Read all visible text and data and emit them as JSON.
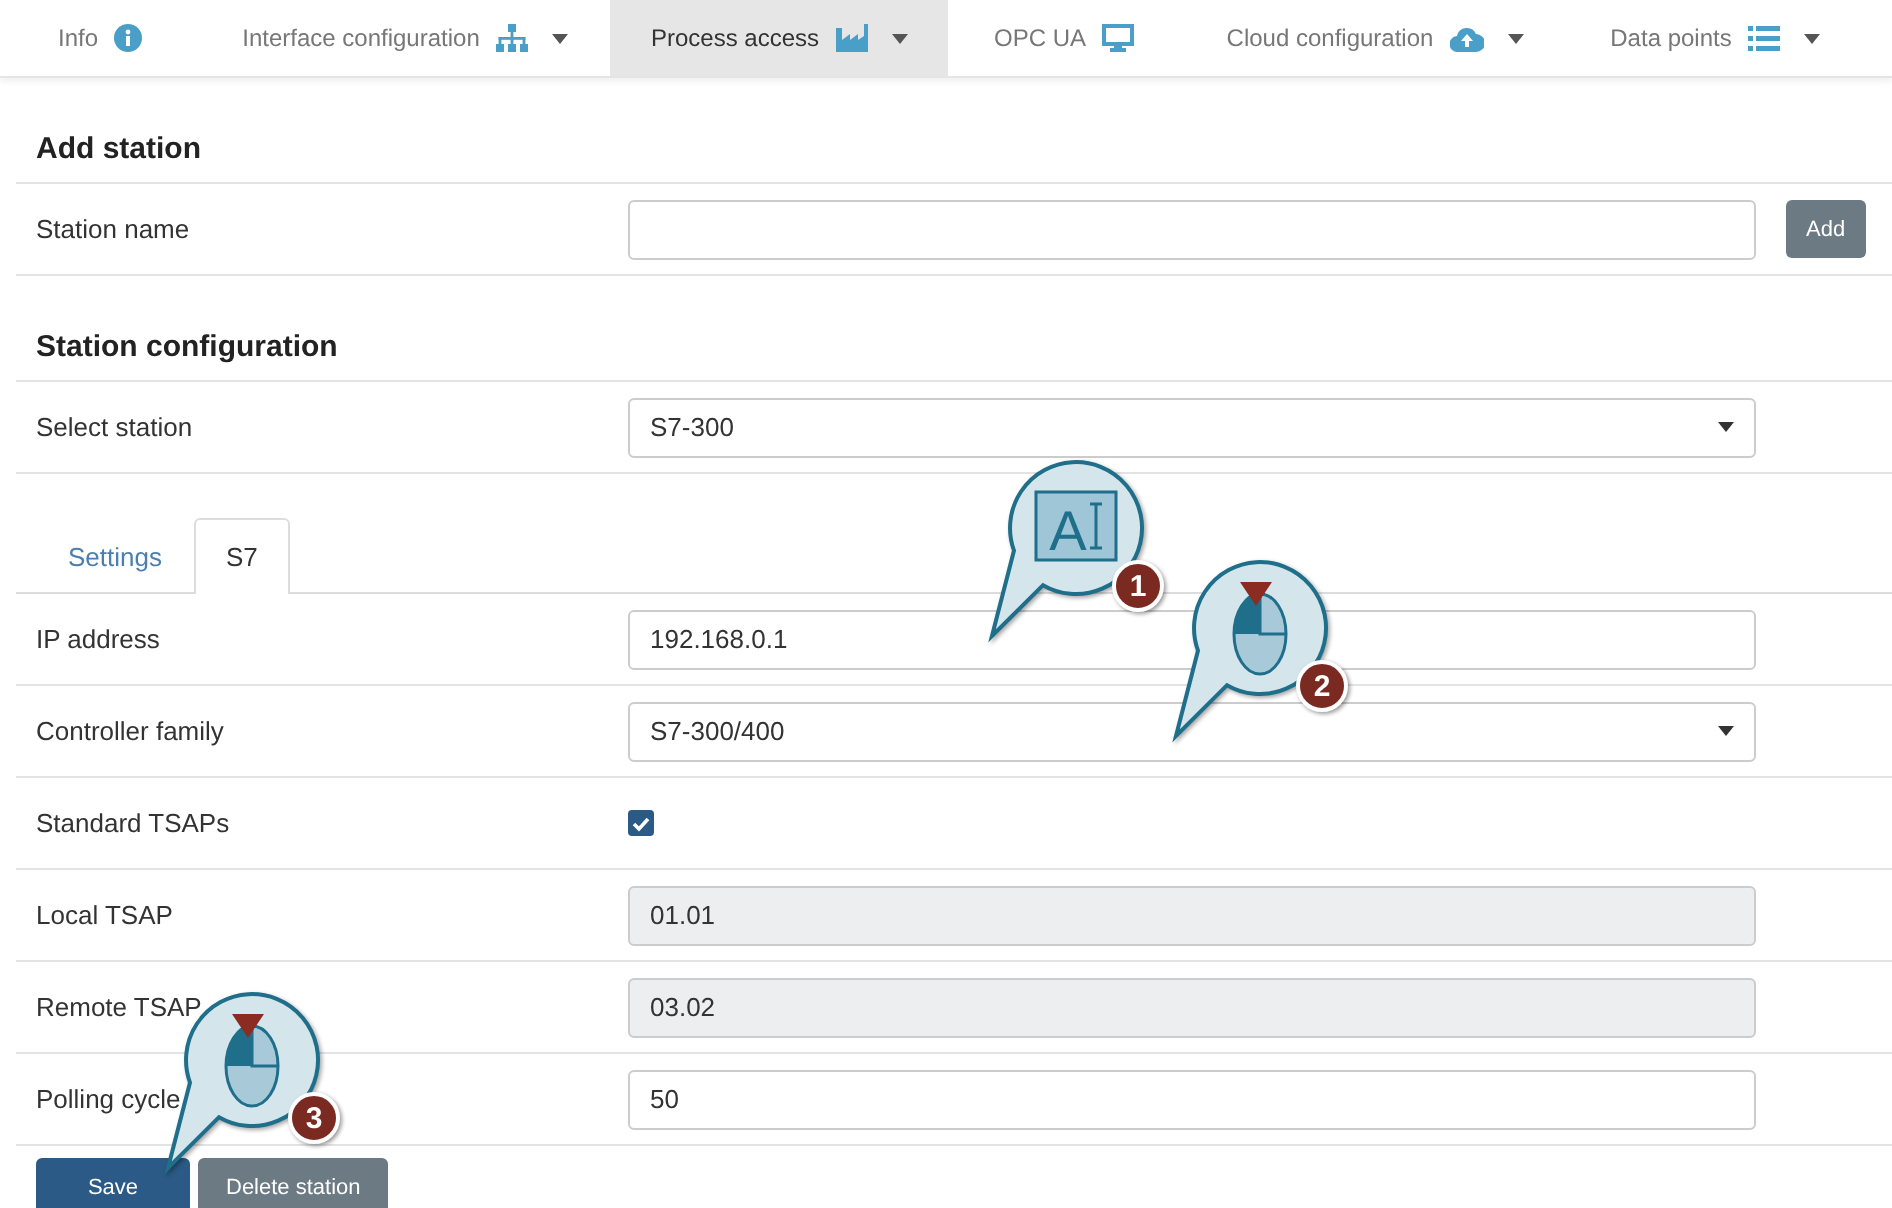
{
  "nav": [
    {
      "label": "Info",
      "dropdown": false,
      "selected": false
    },
    {
      "label": "Interface configuration",
      "dropdown": true,
      "selected": false
    },
    {
      "label": "Process access",
      "dropdown": true,
      "selected": true
    },
    {
      "label": "OPC UA",
      "dropdown": false,
      "selected": false
    },
    {
      "label": "Cloud configuration",
      "dropdown": true,
      "selected": false
    },
    {
      "label": "Data points",
      "dropdown": true,
      "selected": false
    }
  ],
  "add_station": {
    "title": "Add station",
    "label": "Station name",
    "button": "Add"
  },
  "station_configuration": {
    "title": "Station configuration",
    "label": "Select station",
    "value": "S7-300"
  },
  "tabs": [
    {
      "label": "Settings",
      "selected": false
    },
    {
      "label": "S7",
      "selected": true
    }
  ],
  "rows": [
    {
      "kind": "text",
      "label": "IP address",
      "value": "192.168.0.1"
    },
    {
      "kind": "select",
      "label": "Controller family",
      "value": "S7-300/400"
    },
    {
      "kind": "checkbox",
      "label": "Standard TSAPs",
      "checked": true
    },
    {
      "kind": "readonly",
      "label": "Local TSAP",
      "value": "01.01"
    },
    {
      "kind": "readonly",
      "label": "Remote TSAP",
      "value": "03.02"
    },
    {
      "kind": "text",
      "label": "Polling cycle",
      "value": "50"
    }
  ],
  "buttons": [
    {
      "label": "Save",
      "kind": "primary"
    },
    {
      "label": "Delete station",
      "kind": "secondary"
    }
  ],
  "callouts": [
    {
      "number": "1",
      "kind": "text-input",
      "glyph": "A"
    },
    {
      "number": "2",
      "kind": "mouse-click"
    },
    {
      "number": "3",
      "kind": "mouse-click"
    }
  ]
}
